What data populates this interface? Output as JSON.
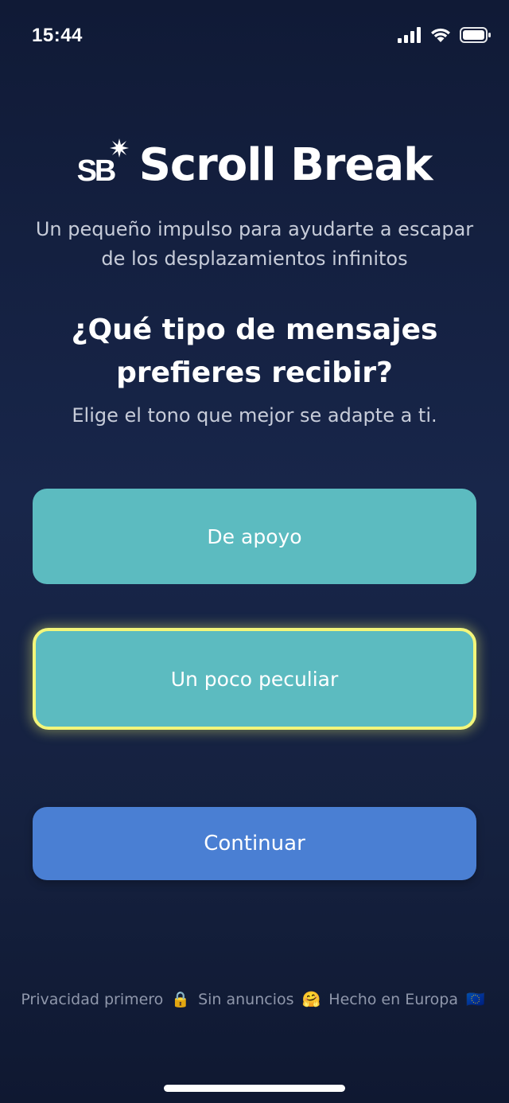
{
  "status_bar": {
    "time": "15:44",
    "icons": [
      "cellular-signal-icon",
      "wifi-icon",
      "battery-icon"
    ]
  },
  "brand": {
    "logo_text": "SB",
    "title": "Scroll Break"
  },
  "subtitle": "Un pequeño impulso para ayudarte a escapar de los desplazamientos infinitos",
  "question": "¿Qué tipo de mensajes prefieres recibir?",
  "hint": "Elige el tono que mejor se adapte a ti.",
  "options": [
    {
      "label": "De apoyo",
      "selected": false
    },
    {
      "label": "Un poco peculiar",
      "selected": true
    }
  ],
  "continue_label": "Continuar",
  "footer": {
    "privacy": "Privacidad primero",
    "privacy_emoji": "🔒",
    "no_ads": "Sin anuncios",
    "no_ads_emoji": "🤗",
    "made_in": "Hecho en Europa",
    "made_in_emoji": "🇪🇺"
  },
  "colors": {
    "background": "#16233f",
    "option": "#5cbbc0",
    "selected_border": "#f3f67a",
    "continue": "#4a7fd3",
    "muted_text": "#c7ccd9"
  }
}
